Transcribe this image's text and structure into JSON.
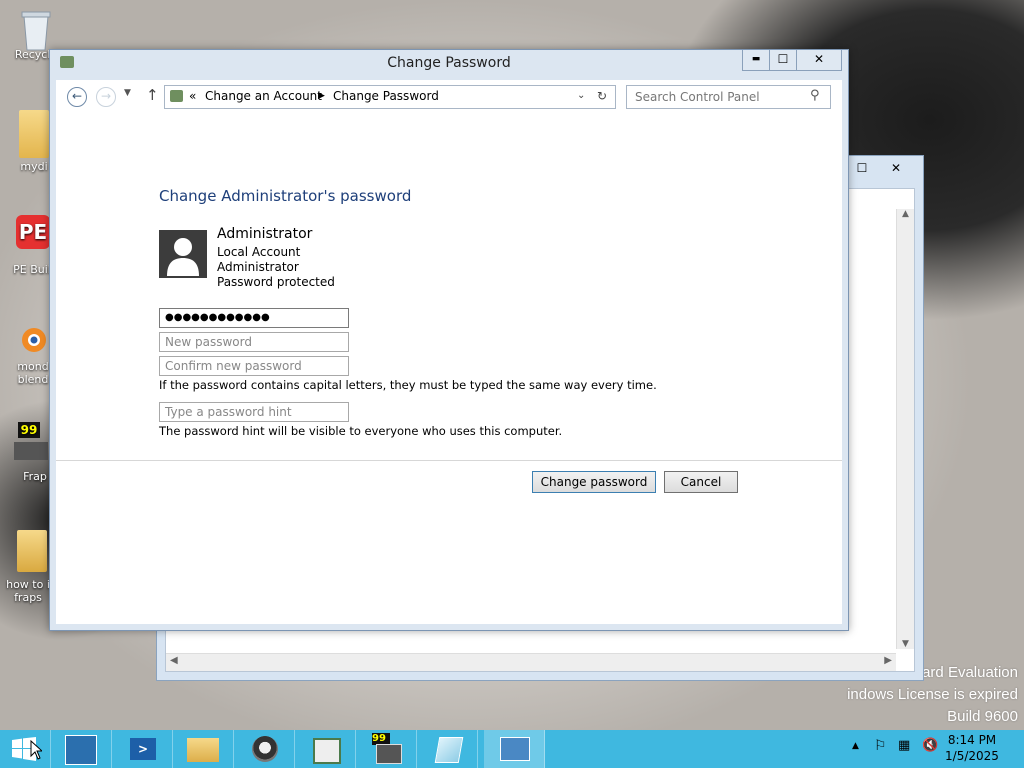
{
  "desktop": {
    "icons": [
      {
        "label": "Recycle"
      },
      {
        "label": "mydi"
      },
      {
        "label": "PE Buil"
      },
      {
        "label": "mond blend"
      },
      {
        "label": "Frap"
      },
      {
        "label": "how to i fraps"
      }
    ],
    "watermark": {
      "line1": "ard Evaluation",
      "line2": "indows License is expired",
      "line3": "Build 9600"
    }
  },
  "window": {
    "title": "Change Password",
    "minimize": "▬",
    "maximize": "☐",
    "close": "✕",
    "breadcrumb": {
      "prefix": "«",
      "items": [
        "Change an Account",
        "Change Password"
      ]
    },
    "search_placeholder": "Search Control Panel"
  },
  "form": {
    "heading": "Change Administrator's password",
    "account": {
      "name": "Administrator",
      "lines": [
        "Local Account",
        "Administrator",
        "Password protected"
      ]
    },
    "current_password_value": "●●●●●●●●●●●●",
    "new_password_placeholder": "New password",
    "confirm_password_placeholder": "Confirm new password",
    "caps_note": "If the password contains capital letters, they must be typed the same way every time.",
    "hint_placeholder": "Type a password hint",
    "hint_note": "The password hint will be visible to everyone who uses this computer.",
    "change_button": "Change password",
    "cancel_button": "Cancel"
  },
  "background_window": {
    "maximize": "☐",
    "close": "✕"
  },
  "taskbar": {
    "time": "8:14 PM",
    "date": "1/5/2025",
    "accent": "#3fb8e0"
  }
}
